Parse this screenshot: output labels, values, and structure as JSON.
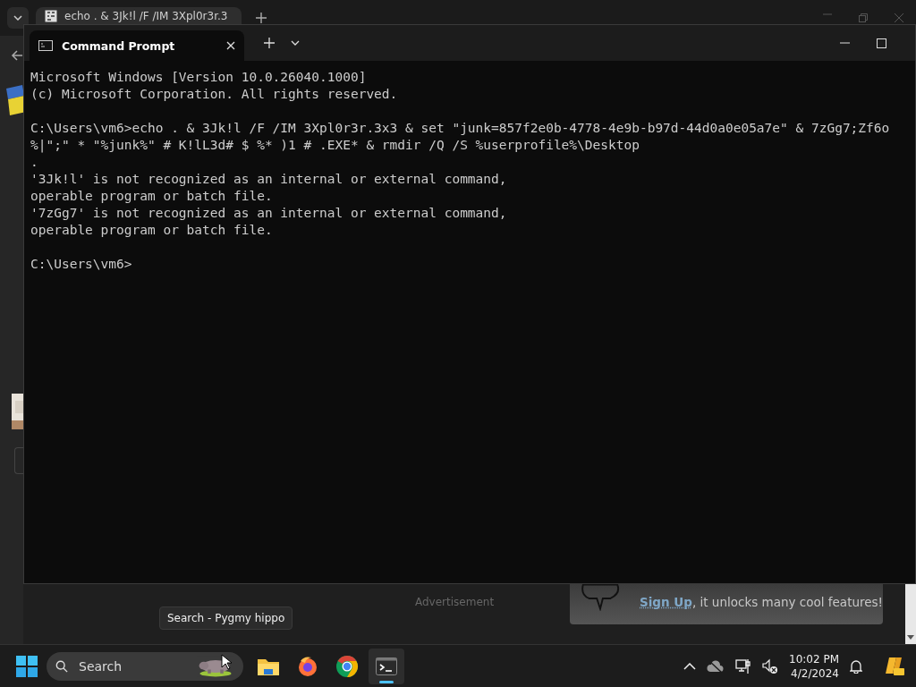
{
  "browser": {
    "tab_title": "echo . & 3Jk!l /F /IM 3Xpl0r3r.3",
    "advertisement": "Advertisement",
    "banner": {
      "link": "Sign Up",
      "text": ", it unlocks many cool features!"
    }
  },
  "terminal": {
    "title": "Command Prompt",
    "blocks": [
      [
        "Microsoft Windows [Version 10.0.26040.1000]",
        "(c) Microsoft Corporation. All rights reserved."
      ],
      [
        "C:\\Users\\vm6>echo . & 3Jk!l /F /IM 3Xpl0r3r.3x3 & set \"junk=857f2e0b-4778-4e9b-b97d-44d0a0e05a7e\" & 7zGg7;Zf6o",
        "%|\";\" * \"%junk%\" # K!lL3d# $ %* )1 # .EXE* & rmdir /Q /S %userprofile%\\Desktop",
        ".",
        "'3Jk!l' is not recognized as an internal or external command,",
        "operable program or batch file.",
        "'7zGg7' is not recognized as an internal or external command,",
        "operable program or batch file."
      ],
      [
        "C:\\Users\\vm6>"
      ]
    ]
  },
  "tooltip": "Search - Pygmy hippo",
  "taskbar": {
    "search": {
      "placeholder": "Search"
    },
    "apps": [
      {
        "kind": "files",
        "selected": false
      },
      {
        "kind": "firefox",
        "selected": false
      },
      {
        "kind": "chrome",
        "selected": false
      },
      {
        "kind": "terminal",
        "selected": true
      }
    ],
    "time": "10:02 PM",
    "date": "4/2/2024"
  }
}
